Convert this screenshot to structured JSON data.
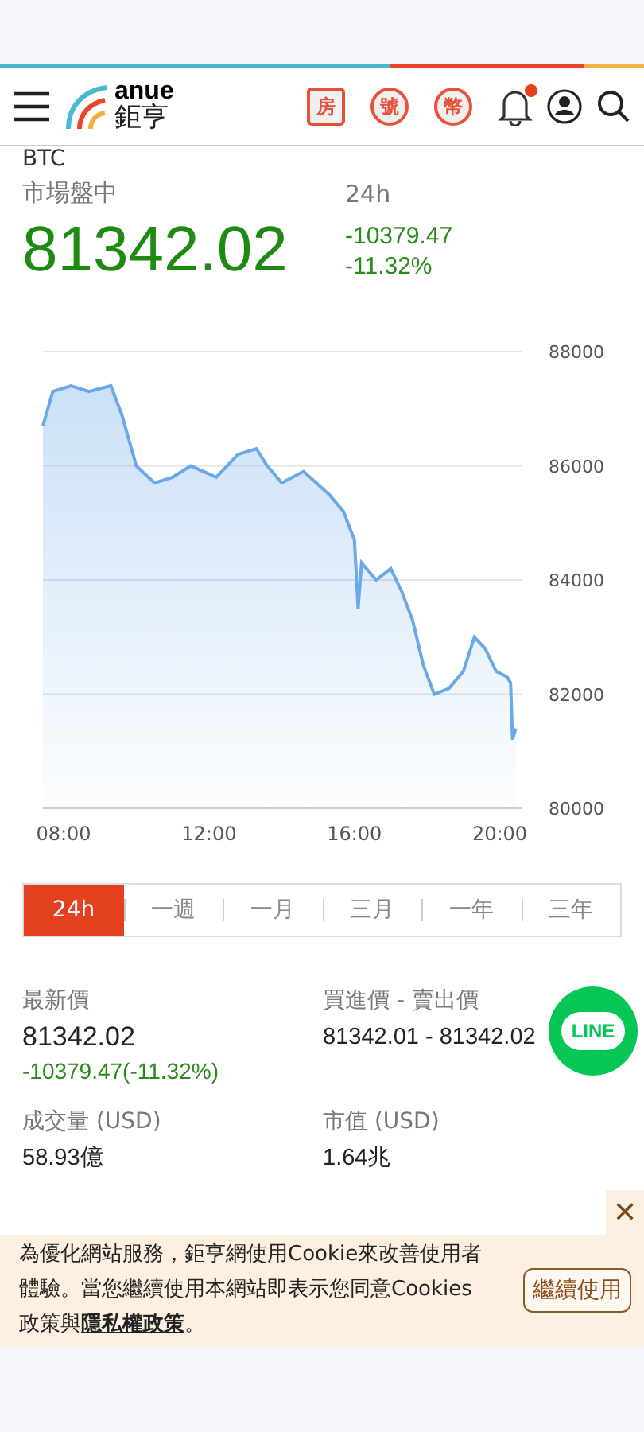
{
  "header": {
    "logo_word": "anue",
    "logo_name": "鉅亨",
    "shortcuts": [
      "房",
      "號",
      "幣"
    ],
    "notification_dot": true
  },
  "quote": {
    "symbol": "BTC",
    "status": "市場盤中",
    "price": "81342.02",
    "period": "24h",
    "change": "-10379.47",
    "change_pct": "-11.32%"
  },
  "chart_data": {
    "type": "area",
    "grid": true,
    "x": [
      7.43,
      7.7,
      8.2,
      8.7,
      9.3,
      9.6,
      10.0,
      10.5,
      11.0,
      11.5,
      12.2,
      12.8,
      13.3,
      13.6,
      14.0,
      14.6,
      15.3,
      15.7,
      16.0,
      16.1,
      16.2,
      16.6,
      17.0,
      17.3,
      17.6,
      17.9,
      18.2,
      18.6,
      19.0,
      19.3,
      19.6,
      19.9,
      20.2,
      20.3,
      20.35,
      20.44
    ],
    "series": [
      {
        "color": "#6aa8e8",
        "values": [
          86700,
          87300,
          87400,
          87300,
          87400,
          86900,
          86000,
          85700,
          85800,
          86000,
          85800,
          86200,
          86300,
          86000,
          85700,
          85900,
          85500,
          85200,
          84700,
          83500,
          84300,
          84000,
          84200,
          83800,
          83300,
          82500,
          82000,
          82100,
          82400,
          83000,
          82800,
          82400,
          82300,
          82200,
          81200,
          81400
        ]
      }
    ],
    "xlim": [
      7.43,
      20.6
    ],
    "ylim": [
      80000,
      88000
    ],
    "xticks": [
      {
        "value": 8,
        "label": "08:00"
      },
      {
        "value": 12,
        "label": "12:00"
      },
      {
        "value": 16,
        "label": "16:00"
      },
      {
        "value": 20,
        "label": "20:00"
      }
    ],
    "yticks": [
      80000,
      82000,
      84000,
      86000,
      88000
    ]
  },
  "ranges": [
    {
      "label": "24h",
      "selected": true
    },
    {
      "label": "一週",
      "selected": false
    },
    {
      "label": "一月",
      "selected": false
    },
    {
      "label": "三月",
      "selected": false
    },
    {
      "label": "一年",
      "selected": false
    },
    {
      "label": "三年",
      "selected": false
    }
  ],
  "stats": [
    {
      "label": "最新價",
      "value": "81342.02",
      "change": "-10379.47(-11.32%)"
    },
    {
      "label": "買進價 - 賣出價",
      "value": "81342.01 - 81342.02"
    },
    {
      "label": "成交量 (USD)",
      "value": "58.93億"
    },
    {
      "label": "市值 (USD)",
      "value": "1.64兆"
    }
  ],
  "line_button": {
    "label": "LINE"
  },
  "cookie_banner": {
    "text": "為優化網站服務，鉅亨網使用Cookie來改善使用者體驗。當您繼續使用本網站即表示您同意Cookies政策與",
    "link": "隱私權政策",
    "end": "。",
    "button": "繼續使用",
    "close": "✕"
  }
}
